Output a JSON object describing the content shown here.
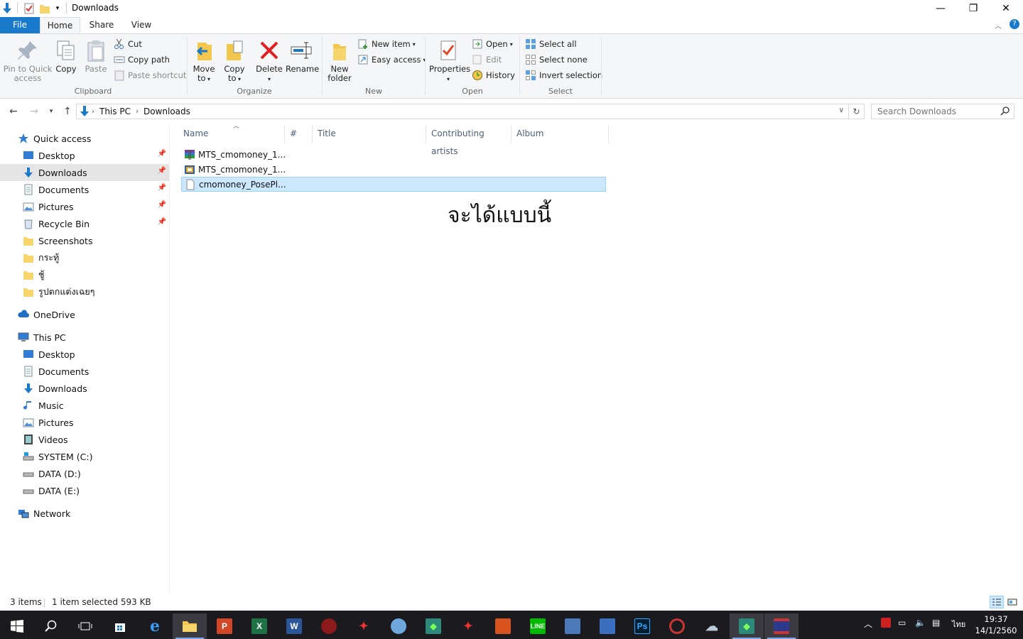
{
  "window": {
    "title": "Downloads",
    "controls": {
      "minimize": "—",
      "restore": "❐",
      "close": "✕"
    }
  },
  "ribbon_tabs": [
    {
      "label": "File"
    },
    {
      "label": "Home"
    },
    {
      "label": "Share"
    },
    {
      "label": "View"
    }
  ],
  "ribbon": {
    "clipboard": {
      "label": "Clipboard",
      "pin": "Pin to Quick\naccess",
      "copy": "Copy",
      "paste": "Paste",
      "cut": "Cut",
      "copy_path": "Copy path",
      "paste_shortcut": "Paste shortcut"
    },
    "organize": {
      "label": "Organize",
      "move_to": "Move\nto",
      "copy_to": "Copy\nto",
      "delete": "Delete",
      "rename": "Rename"
    },
    "new": {
      "label": "New",
      "new_folder": "New\nfolder",
      "new_item": "New item",
      "easy_access": "Easy access"
    },
    "open": {
      "label": "Open",
      "properties": "Properties",
      "open": "Open",
      "edit": "Edit",
      "history": "History"
    },
    "select": {
      "label": "Select",
      "select_all": "Select all",
      "select_none": "Select none",
      "invert_selection": "Invert selection"
    }
  },
  "address": {
    "crumbs": [
      "This PC",
      "Downloads"
    ],
    "search_placeholder": "Search Downloads"
  },
  "nav": {
    "quick_access": "Quick access",
    "quick_items": [
      {
        "label": "Desktop",
        "icon": "desktop-icon"
      },
      {
        "label": "Downloads",
        "icon": "downloads-icon"
      },
      {
        "label": "Documents",
        "icon": "documents-icon"
      },
      {
        "label": "Pictures",
        "icon": "pictures-icon"
      },
      {
        "label": "Recycle Bin",
        "icon": "recycle-bin-icon"
      },
      {
        "label": "Screenshots",
        "icon": "folder-icon"
      },
      {
        "label": "กระทู้",
        "icon": "folder-icon"
      },
      {
        "label": "ชู้",
        "icon": "folder-icon"
      },
      {
        "label": "รูปตกแต่งเฉยๆ",
        "icon": "folder-icon"
      }
    ],
    "onedrive": "OneDrive",
    "this_pc": "This PC",
    "pc_items": [
      {
        "label": "Desktop",
        "icon": "desktop-icon"
      },
      {
        "label": "Documents",
        "icon": "documents-icon"
      },
      {
        "label": "Downloads",
        "icon": "downloads-icon"
      },
      {
        "label": "Music",
        "icon": "music-icon"
      },
      {
        "label": "Pictures",
        "icon": "pictures-icon"
      },
      {
        "label": "Videos",
        "icon": "videos-icon"
      },
      {
        "label": "SYSTEM (C:)",
        "icon": "system-drive-icon"
      },
      {
        "label": "DATA (D:)",
        "icon": "drive-icon"
      },
      {
        "label": "DATA (E:)",
        "icon": "drive-icon"
      }
    ],
    "network": "Network"
  },
  "columns": [
    "Name",
    "#",
    "Title",
    "Contributing artists",
    "Album"
  ],
  "files": [
    {
      "name": "MTS_cmomoney_1...",
      "icon": "archive-icon"
    },
    {
      "name": "MTS_cmomoney_1...",
      "icon": "package-icon"
    },
    {
      "name": "cmomoney_PosePl...",
      "icon": "file-icon"
    }
  ],
  "overlay_text": "จะได้แบบนี้",
  "status": {
    "item_count": "3 items",
    "selection": "1 item selected  593 KB"
  },
  "taskbar": {
    "clock_time": "19:37",
    "clock_date": "14/1/2560",
    "language": "ไทย"
  },
  "colors": {
    "accent": "#1979ca",
    "selection": "#cce8ff",
    "taskbar": "#1a1a1f"
  }
}
